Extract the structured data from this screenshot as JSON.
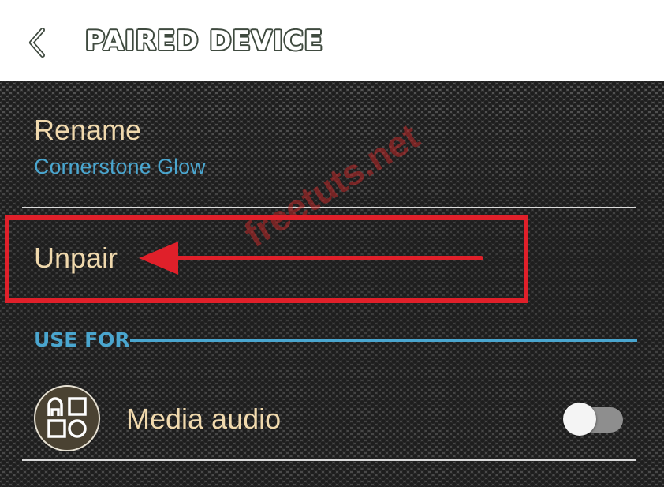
{
  "header": {
    "title": "PAIRED DEVICE",
    "back_icon": "chevron-left-icon"
  },
  "rename": {
    "label": "Rename",
    "value": "Cornerstone Glow"
  },
  "unpair": {
    "label": "Unpair"
  },
  "annotation": {
    "watermark": "freetuts.net",
    "arrow_icon": "arrow-left-icon",
    "highlight_color": "#e0202a"
  },
  "use_for": {
    "section_label": "USE FOR",
    "items": [
      {
        "label": "Media audio",
        "icon": "media-apps-icon",
        "enabled": false
      }
    ]
  },
  "colors": {
    "accent": "#4aa6cf",
    "text_primary": "#f0d9ad",
    "title_outline": "#3f4a3f"
  }
}
